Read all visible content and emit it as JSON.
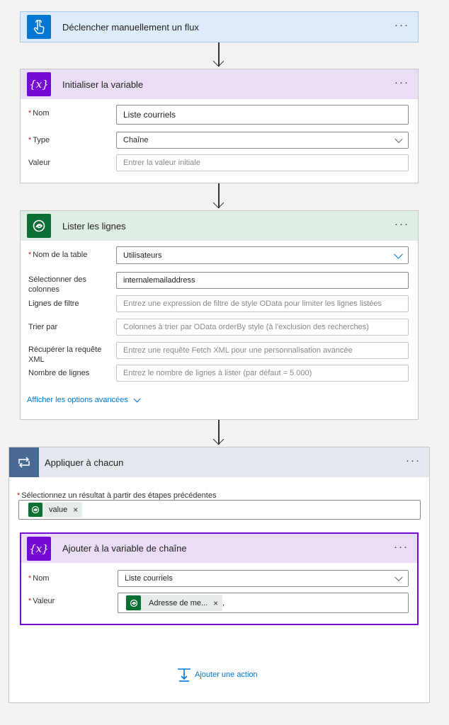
{
  "trigger": {
    "title": "Déclencher manuellement un flux",
    "icon": "hand-touch-icon",
    "color": "#0078d4",
    "more": "···"
  },
  "init_var": {
    "title": "Initialiser la variable",
    "icon": "variable-icon",
    "icon_text": "{x}",
    "color": "#770bd6",
    "more": "···",
    "name_label": "Nom",
    "name_value": "Liste courriels",
    "type_label": "Type",
    "type_value": "Chaîne",
    "value_label": "Valeur",
    "value_placeholder": "Entrer la valeur initiale",
    "required_mark": "*"
  },
  "list_rows": {
    "title": "Lister les lignes",
    "icon": "dataverse-icon",
    "color": "#0b6e35",
    "more": "···",
    "table_label": "Nom de la table",
    "table_value": "Utilisateurs",
    "select_label": "Sélectionner des colonnes",
    "select_value": "internalemailaddress",
    "filter_label": "Lignes de filtre",
    "filter_placeholder": "Entrez une expression de filtre de style OData pour limiter les lignes listées",
    "sort_label": "Trier par",
    "sort_placeholder": "Colonnes à trier par OData orderBy style (à l'exclusion des recherches)",
    "fetch_label": "Récupérer la requête XML",
    "fetch_placeholder": "Entrez une requête Fetch XML pour une personnalisation avancée",
    "count_label": "Nombre de lignes",
    "count_placeholder": "Entrez le nombre de lignes à lister (par défaut = 5 000)",
    "advanced_link": "Afficher les options avancées",
    "required_mark": "*"
  },
  "apply_each": {
    "title": "Appliquer à chacun",
    "icon": "loop-icon",
    "color": "#486991",
    "more": "···",
    "select_label": "Sélectionnez un résultat à partir des étapes précédentes",
    "token_label": "value",
    "token_close": "×",
    "required_mark": "*"
  },
  "append_var": {
    "title": "Ajouter à la variable de chaîne",
    "icon": "variable-icon",
    "icon_text": "{x}",
    "color": "#770bd6",
    "more": "···",
    "name_label": "Nom",
    "name_value": "Liste courriels",
    "value_label": "Valeur",
    "token_label": "Adresse de me...",
    "token_close": "×",
    "trailing_text": ",",
    "required_mark": "*"
  },
  "add_action": {
    "label": "Ajouter une action",
    "icon": "add-action-icon"
  }
}
